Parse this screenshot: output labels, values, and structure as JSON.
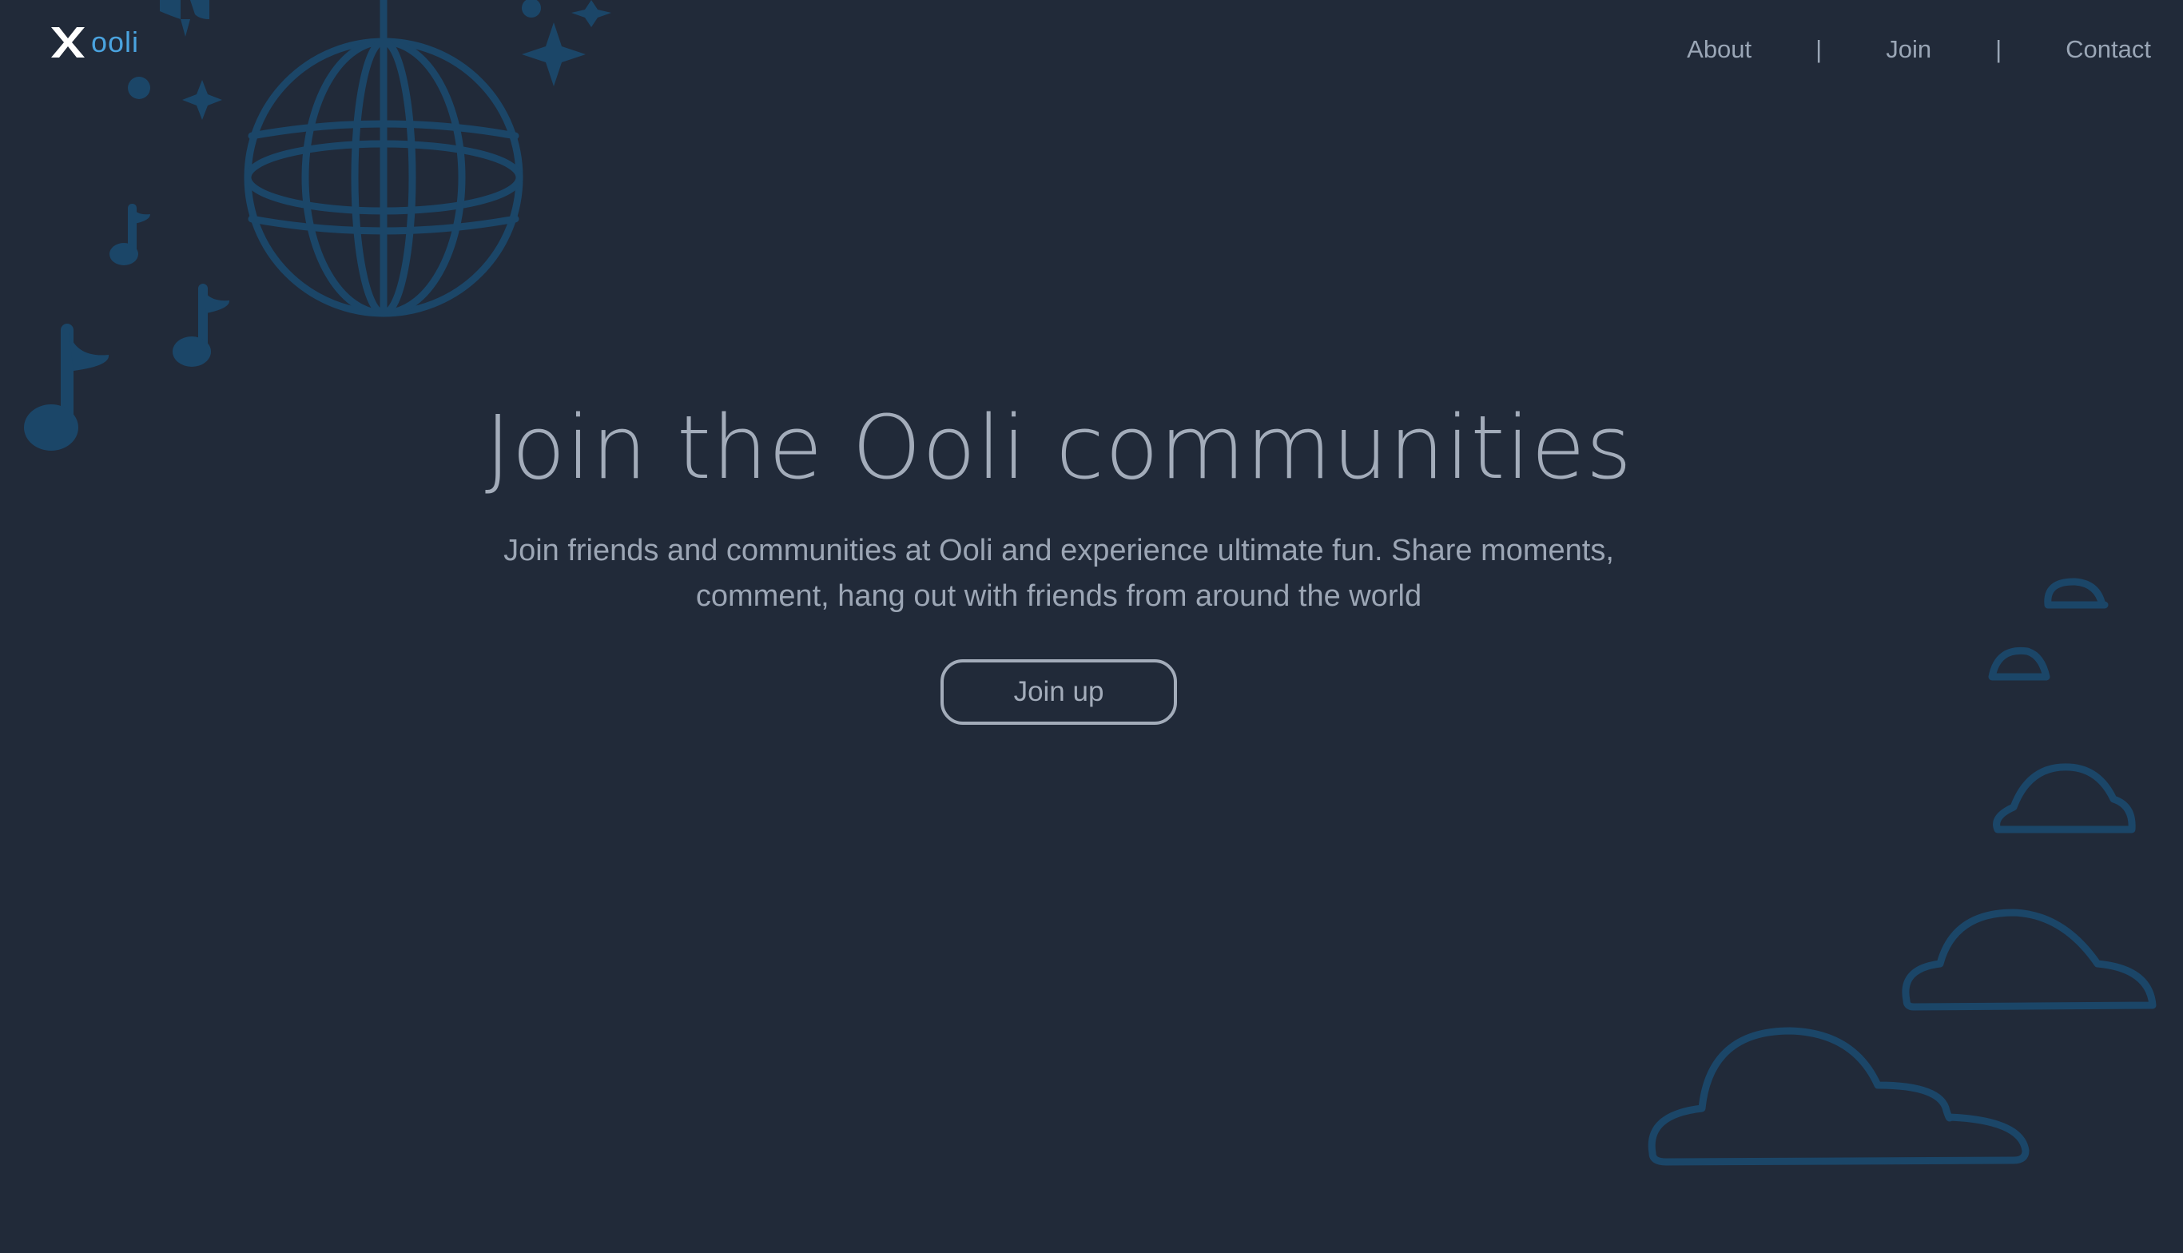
{
  "brand": {
    "name": "ooli",
    "accent_color": "#4aa3df",
    "decor_color": "#1b4668"
  },
  "nav": {
    "items": [
      {
        "label": "About"
      },
      {
        "label": "Join"
      },
      {
        "label": "Contact"
      }
    ],
    "separator": "|"
  },
  "hero": {
    "title": "Join the Ooli communities",
    "subtitle": "Join friends and communities at Ooli and experience ultimate fun. Share moments, comment, hang out with friends from around the world",
    "cta_label": "Join up"
  },
  "theme": {
    "background": "#212a39",
    "text": "#a3acba"
  }
}
